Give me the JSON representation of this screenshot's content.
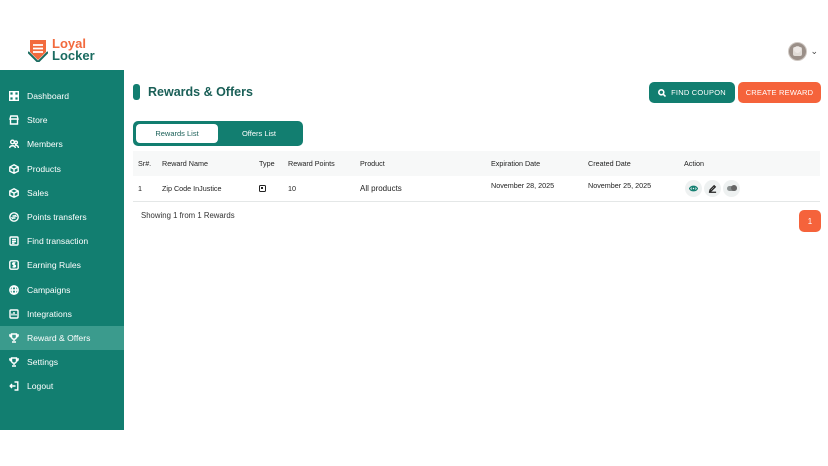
{
  "brand": {
    "line1": "Loyal",
    "line2": "Locker",
    "accent": "#f26a3d",
    "primary": "#127e70"
  },
  "sidebar": {
    "items": [
      {
        "label": "Dashboard",
        "icon": "grid-icon"
      },
      {
        "label": "Store",
        "icon": "store-icon"
      },
      {
        "label": "Members",
        "icon": "users-icon"
      },
      {
        "label": "Products",
        "icon": "box-icon"
      },
      {
        "label": "Sales",
        "icon": "box-icon"
      },
      {
        "label": "Points transfers",
        "icon": "transfer-icon"
      },
      {
        "label": "Find transaction",
        "icon": "receipt-icon"
      },
      {
        "label": "Earning Rules",
        "icon": "dollar-icon"
      },
      {
        "label": "Campaigns",
        "icon": "globe-icon"
      },
      {
        "label": "Integrations",
        "icon": "plug-icon"
      },
      {
        "label": "Reward & Offers",
        "icon": "trophy-icon",
        "active": true
      },
      {
        "label": "Settings",
        "icon": "trophy-icon"
      },
      {
        "label": "Logout",
        "icon": "logout-icon"
      }
    ]
  },
  "header": {
    "title": "Rewards & Offers",
    "find_coupon": "FIND COUPON",
    "create_reward": "CREATE REWARD"
  },
  "tabs": [
    {
      "label": "Rewards List",
      "active": true
    },
    {
      "label": "Offers List",
      "active": false
    }
  ],
  "table": {
    "columns": [
      "Sr#.",
      "Reward Name",
      "Type",
      "Reward Points",
      "Product",
      "Expiration Date",
      "Created Date",
      "Action"
    ],
    "rows": [
      {
        "sr": "1",
        "name": "Zip Code InJustice",
        "points": "10",
        "product": "All products",
        "expiration": "November 28, 2025",
        "created": "November 25, 2025"
      }
    ]
  },
  "footer": {
    "showing": "Showing 1 from 1 Rewards",
    "page": "1"
  }
}
